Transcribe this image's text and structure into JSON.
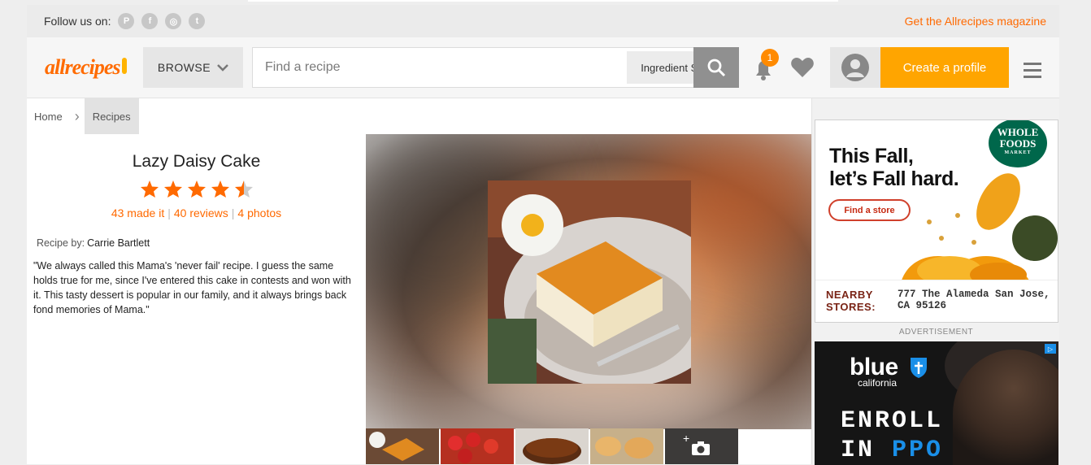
{
  "follow_bar": {
    "label": "Follow us on:",
    "social_icons": [
      "pinterest-icon",
      "facebook-icon",
      "instagram-icon",
      "twitter-icon"
    ],
    "magazine_link": "Get the Allrecipes magazine"
  },
  "header": {
    "logo_text": "allrecipes",
    "browse_label": "BROWSE",
    "search_placeholder": "Find a recipe",
    "ingredient_search_label": "Ingredient Search",
    "notification_count": "1",
    "create_profile_label": "Create a profile"
  },
  "breadcrumb": {
    "items": [
      "Home",
      "Recipes"
    ]
  },
  "recipe": {
    "title": "Lazy Daisy Cake",
    "rating": 4.5,
    "made_it": "43 made it",
    "reviews": "40 reviews",
    "photos": "4 photos",
    "recipe_by_label": "Recipe by:",
    "author": "Carrie Bartlett",
    "description": "\"We always called this Mama's 'never fail' recipe. I guess the same holds true for me, since I've entered this cake in contests and won with it. This tasty dessert is popular in our family, and it always brings back fond memories of Mama.\""
  },
  "ads": {
    "whole_foods": {
      "logo_text": "WHOLE FOODS",
      "logo_sub": "MARKET",
      "headline_line1": "This Fall,",
      "headline_line2": "let’s Fall hard.",
      "cta": "Find a store",
      "nearby_label_1": "NEARBY",
      "nearby_label_2": "STORES:",
      "address_line1": "777 The Alameda San Jose,",
      "address_line2": "CA 95126"
    },
    "advertisement_label": "ADVERTISEMENT",
    "blue_shield": {
      "brand": "blue",
      "sub": "california",
      "line1": "ENROLL",
      "line2_a": "IN",
      "line2_b": "PPO"
    }
  },
  "colors": {
    "brand_orange": "#ff6900",
    "create_button": "#ffa500",
    "badge": "#ff8a00",
    "star": "#ff6a00"
  }
}
